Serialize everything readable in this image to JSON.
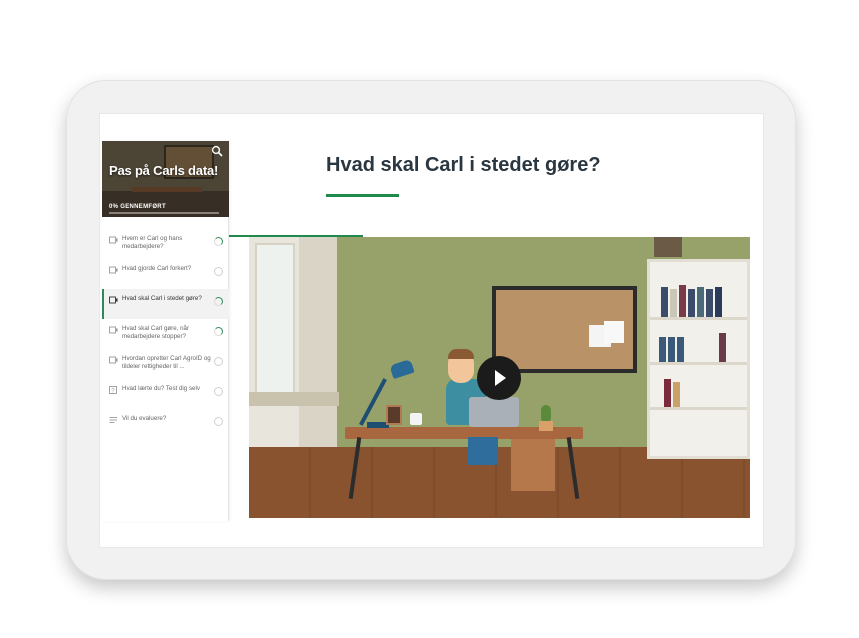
{
  "course": {
    "title": "Pas på Carls data!",
    "progress_label": "0% GENNEMFØRT",
    "progress_fraction": 0.0
  },
  "lessons": [
    {
      "label": "Hvem er Carl og hans medarbejdere?",
      "icon": "video-icon",
      "status": "partial"
    },
    {
      "label": "Hvad gjorde Carl forkert?",
      "icon": "video-icon",
      "status": "not-started"
    },
    {
      "label": "Hvad skal Carl i stedet gøre?",
      "icon": "video-icon",
      "status": "partial",
      "active": true
    },
    {
      "label": "Hvad skal Carl gøre, når medarbejdere stopper?",
      "icon": "video-icon",
      "status": "partial"
    },
    {
      "label": "Hvordan opretter Carl AgroID og tildeler rettigheder til ...",
      "icon": "video-icon",
      "status": "not-started"
    },
    {
      "label": "Hvad lærte du? Test dig selv",
      "icon": "quiz-icon",
      "status": "not-started"
    },
    {
      "label": "Vil du evaluere?",
      "icon": "list-icon",
      "status": "not-started"
    }
  ],
  "main": {
    "lesson_title": "Hvad skal Carl i stedet gøre?"
  },
  "colors": {
    "accent": "#1f8a4c",
    "title": "#2a3640"
  },
  "icons": {
    "search": "search-icon",
    "play": "play-icon"
  }
}
